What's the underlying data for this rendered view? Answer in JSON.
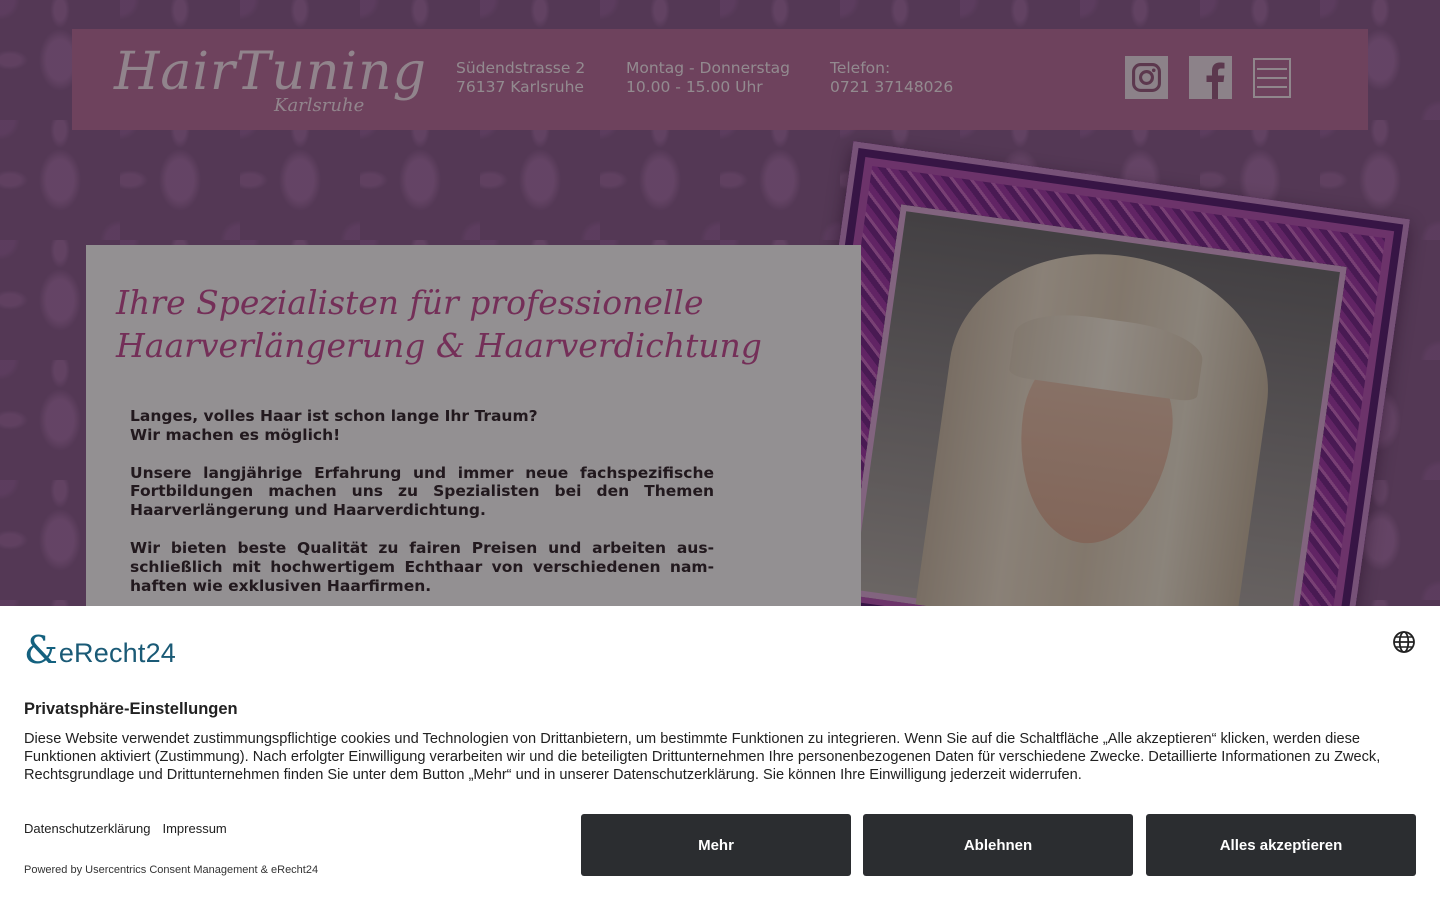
{
  "header": {
    "logo_main": "HairTuning",
    "logo_sub": "Karlsruhe",
    "address_line1": "Südendstrasse 2",
    "address_line2": "76137 Karlsruhe",
    "hours_line1": "Montag - Donnerstag",
    "hours_line2": "10.00 - 15.00 Uhr",
    "phone_label": "Telefon:",
    "phone_number": "0721 37148026"
  },
  "hero": {
    "heading_line1": "Ihre Spezialisten für professionelle",
    "heading_line2": "Haarverlängerung & Haarverdichtung",
    "para1_line1": "Langes, volles Haar ist schon lange Ihr Traum?",
    "para1_line2": "Wir machen es möglich!",
    "para2": "Unsere langjährige Erfahrung und immer neue fachspezifische Fortbildungen machen uns zu Spezialisten bei den Themen Haarverlängerung und Haarverdichtung.",
    "para3": "Wir bieten beste Qualität zu fairen Preisen und arbeiten aus­schließlich mit hochwertigem Echthaar von verschiedenen nam­haften wie exklusiven Haarfirmen."
  },
  "consent": {
    "brand": "eRecht24",
    "title": "Privatsphäre-Einstellungen",
    "description": "Diese Website verwendet zustimmungspflichtige cookies und Technologien von Drittanbietern, um bestimmte Funktionen zu integrieren. Wenn Sie auf die Schaltfläche „Alle akzeptieren“ klicken, werden diese Funktionen aktiviert (Zustimmung). Nach erfolgter Einwilligung verarbeiten wir und die beteiligten Drittunternehmen Ihre personenbezogenen Daten für verschiedene Zwecke. Detaillierte Informationen zu Zweck, Rechtsgrundlage und Drittunternehmen finden Sie unter dem Button „Mehr“ und in unserer Datenschutzerklärung. Sie können Ihre Einwilligung jederzeit widerrufen.",
    "link_privacy": "Datenschutzerklärung",
    "link_imprint": "Impressum",
    "powered_by": "Powered by Usercentrics Consent Management & eRecht24",
    "btn_more": "Mehr",
    "btn_decline": "Ablehnen",
    "btn_accept": "Alles akzeptieren"
  },
  "colors": {
    "header_bg": "#b86e9b",
    "heading_pink": "#c14f93",
    "button_dark": "#2b2d30",
    "brand_blue": "#1a5a76"
  },
  "icons": [
    "instagram-icon",
    "facebook-icon",
    "hamburger-menu-icon",
    "globe-icon",
    "erecht24-logo-icon"
  ]
}
